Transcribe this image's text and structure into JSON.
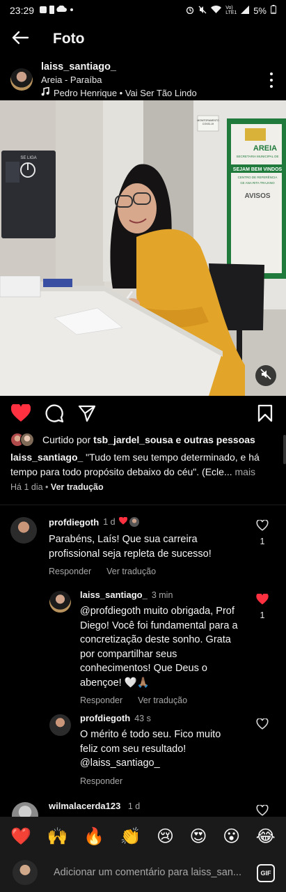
{
  "status_bar": {
    "time": "23:29",
    "battery": "5%",
    "network": "Vo) LTE1"
  },
  "nav": {
    "title": "Foto"
  },
  "post": {
    "username": "laiss_santiago_",
    "location": "Areia - Paraíba",
    "music": "Pedro Henrique • Vai Ser Tão Lindo",
    "photo_sign": {
      "brand": "AREIA",
      "line1": "SECRETARIA MUNICIPAL DE",
      "line2": "SEJAM BEM VINDOS",
      "line3": "CENTRO DE REFERÊNCIA",
      "line4": "CE ANA RITA TRAJANO",
      "avisos": "AVISOS",
      "dispenser": "SE LIGA",
      "small_sign_1": "MONITORAMENTO",
      "small_sign_2": "COVID-19"
    },
    "liked_by_prefix": "Curtido por",
    "liked_by_user": "tsb_jardel_sousa",
    "liked_by_suffix": "e outras pessoas",
    "caption_user": "laiss_santiago_",
    "caption_text": "\"Tudo tem seu tempo determinado, e há tempo para todo propósito debaixo do céu\". (Ecle...",
    "caption_more": "mais",
    "age": "Há 1 dia",
    "separator": "•",
    "translate": "Ver tradução"
  },
  "comments": [
    {
      "user": "profdiegoth",
      "time": "1 d",
      "text": "Parabéns, Laís! Que sua carreira profissional seja repleta de sucesso!",
      "reply": "Responder",
      "translate": "Ver tradução",
      "likes": "1",
      "liked": false
    },
    {
      "user": "laiss_santiago_",
      "time": "3 min",
      "text": "@profdiegoth muito obrigada, Prof Diego! Você foi fundamental para a concretização deste sonho. Grata por compartilhar seus conhecimentos! Que Deus o abençoe! 🤍🙏🏽",
      "reply": "Responder",
      "translate": "Ver tradução",
      "likes": "1",
      "liked": true
    },
    {
      "user": "profdiegoth",
      "time": "43 s",
      "text": "O mérito é todo seu. Fico muito feliz com seu resultado! @laiss_santiago_",
      "reply": "Responder",
      "liked": false
    },
    {
      "user": "wilmalacerda123",
      "time": "1 d"
    }
  ],
  "emoji_reactions": [
    "❤️",
    "🙌",
    "🔥",
    "👏",
    "😢",
    "😍",
    "😮",
    "😂"
  ],
  "comment_input": {
    "placeholder": "Adicionar um comentário para laiss_san...",
    "gif_label": "GIF"
  },
  "colors": {
    "background": "#000000",
    "like_red": "#ff3040",
    "secondary_text": "#a8a8a8",
    "sign_green": "#1f7a3c"
  },
  "icons": {
    "back": "arrow-left-icon",
    "more": "more-vertical-icon",
    "music": "music-note-icon",
    "mute": "volume-off-icon",
    "like": "heart-filled-icon",
    "comment": "comment-bubble-icon",
    "share": "paper-plane-icon",
    "save": "bookmark-icon",
    "comment_like": "heart-outline-icon"
  }
}
